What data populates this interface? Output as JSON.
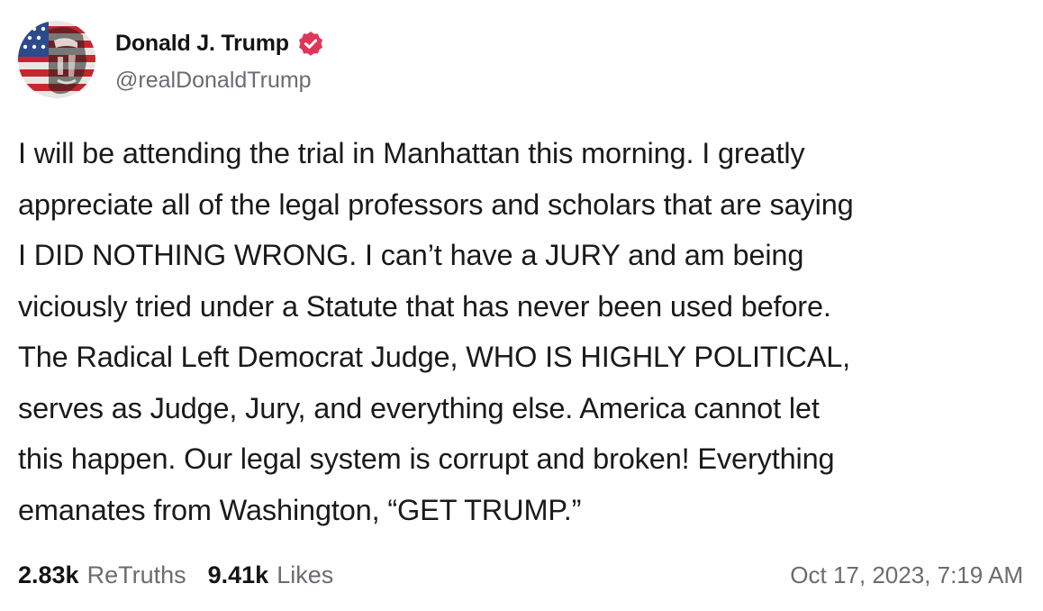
{
  "author": {
    "display_name": "Donald J. Trump",
    "handle": "@realDonaldTrump",
    "verified_icon": "verified-badge-icon",
    "avatar_icon": "flag-portrait-avatar"
  },
  "post": {
    "text": "I will be attending the trial in Manhattan this morning. I greatly\nappreciate all of the legal professors and scholars that are saying\nI DID NOTHING WRONG. I can’t have a JURY and am being\nviciously tried under a Statute that has never been used before.\nThe Radical Left Democrat Judge, WHO IS HIGHLY POLITICAL,\nserves as Judge, Jury, and everything else. America cannot let\nthis happen. Our legal system is corrupt and broken! Everything\nemanates from Washington, “GET TRUMP.”"
  },
  "stats": {
    "retruths_count": "2.83k",
    "retruths_label": "ReTruths",
    "likes_count": "9.41k",
    "likes_label": "Likes"
  },
  "timestamp": "Oct 17, 2023, 7:19 AM",
  "colors": {
    "verified": "#e0365a",
    "muted_text": "#6b6b73",
    "body_text": "#1a1a1a"
  }
}
